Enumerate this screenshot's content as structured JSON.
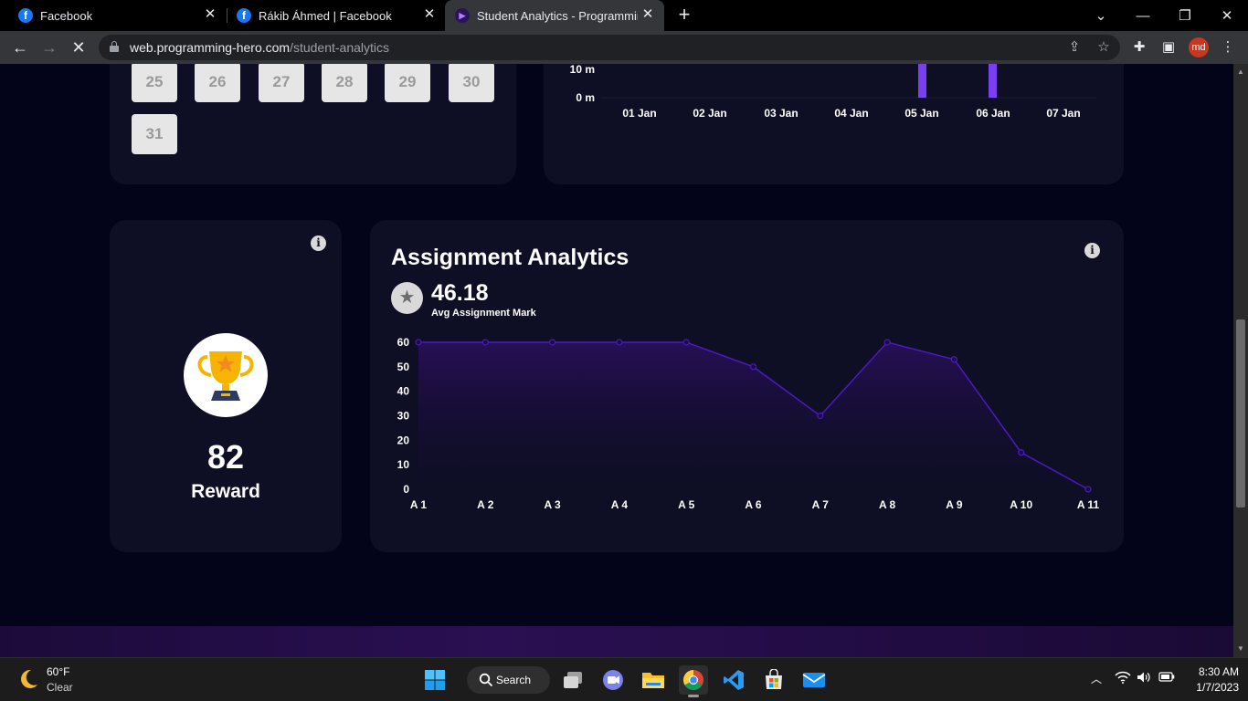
{
  "browser": {
    "tabs": [
      {
        "title": "Facebook",
        "icon": "facebook-icon",
        "active": false
      },
      {
        "title": "Rákib Áhmed | Facebook",
        "icon": "facebook-icon",
        "active": false
      },
      {
        "title": "Student Analytics - Programming",
        "icon": "programming-hero-icon",
        "active": true
      }
    ],
    "url_host": "web.programming-hero.com",
    "url_path": "/student-analytics",
    "profile_initials": "md"
  },
  "calendar": {
    "days": [
      "25",
      "26",
      "27",
      "28",
      "29",
      "30",
      "31"
    ]
  },
  "time_chart": {
    "y_ticks": [
      "0 m",
      "10 m"
    ],
    "x_labels": [
      "01 Jan",
      "02 Jan",
      "03 Jan",
      "04 Jan",
      "05 Jan",
      "06 Jan",
      "07 Jan"
    ],
    "bar_color": "#7b3ff2"
  },
  "reward": {
    "value": "82",
    "label": "Reward"
  },
  "assignment": {
    "title": "Assignment Analytics",
    "avg_value": "46.18",
    "avg_label": "Avg Assignment Mark"
  },
  "chart_data": {
    "type": "area",
    "x": [
      "A 1",
      "A 2",
      "A 3",
      "A 4",
      "A 5",
      "A 6",
      "A 7",
      "A 8",
      "A 9",
      "A 10",
      "A 11"
    ],
    "series": [
      {
        "values": [
          60,
          60,
          60,
          60,
          60,
          50,
          30,
          60,
          53,
          15,
          0
        ]
      }
    ],
    "y_ticks": [
      0,
      10,
      20,
      30,
      40,
      50,
      60
    ],
    "ylim": [
      0,
      60
    ],
    "line_color": "#4a1bc0",
    "fill_color": "#2a0f5c"
  },
  "taskbar": {
    "weather_temp": "60°F",
    "weather_condition": "Clear",
    "search_label": "Search",
    "time": "8:30 AM",
    "date": "1/7/2023"
  },
  "colors": {
    "page_bg": "#03031a",
    "card_bg": "#0e0e25",
    "accent": "#7b3ff2"
  }
}
